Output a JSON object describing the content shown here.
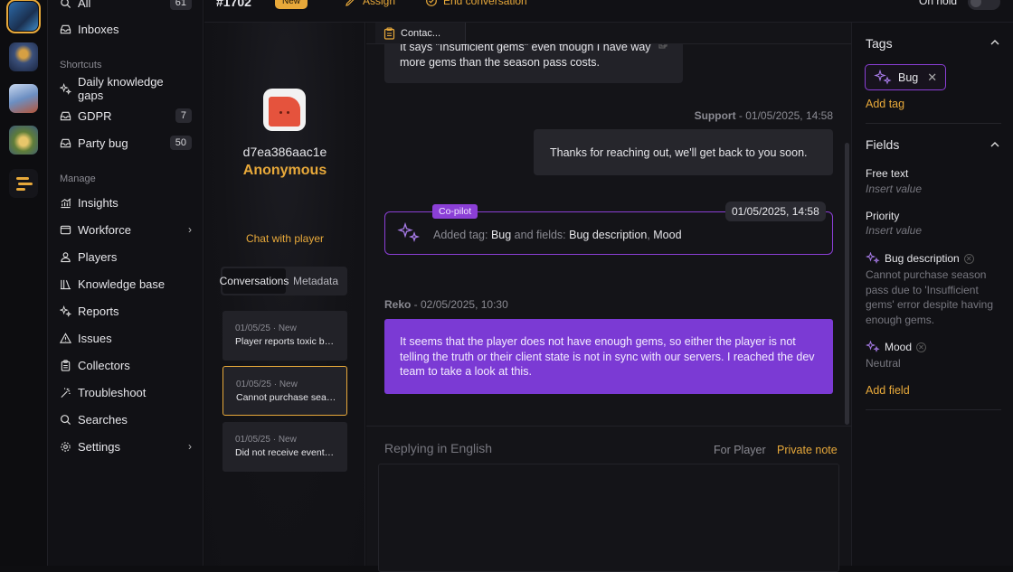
{
  "topbar": {
    "ticket_id": "#1702",
    "status_badge": "New",
    "assign_label": "Assign",
    "end_label": "End conversation",
    "on_hold_label": "On hold"
  },
  "sidebar": {
    "top_item": {
      "label": "All",
      "count": "61"
    },
    "inboxes": {
      "label": "Inboxes"
    },
    "shortcuts_title": "Shortcuts",
    "shortcuts": [
      {
        "label": "Daily knowledge gaps",
        "icon": "sparkle-icon"
      },
      {
        "label": "GDPR",
        "icon": "inbox-icon",
        "count": "7"
      },
      {
        "label": "Party bug",
        "icon": "inbox-icon",
        "count": "50"
      }
    ],
    "manage_title": "Manage",
    "manage": [
      {
        "label": "Insights",
        "icon": "chart-icon"
      },
      {
        "label": "Workforce",
        "icon": "window-icon"
      },
      {
        "label": "Players",
        "icon": "user-icon"
      },
      {
        "label": "Knowledge base",
        "icon": "library-icon"
      },
      {
        "label": "Reports",
        "icon": "sparkle-icon"
      },
      {
        "label": "Issues",
        "icon": "warning-icon"
      },
      {
        "label": "Collectors",
        "icon": "clipboard-icon"
      },
      {
        "label": "Troubleshoot",
        "icon": "wand-icon"
      },
      {
        "label": "Searches",
        "icon": "search-icon"
      },
      {
        "label": "Settings",
        "icon": "gear-icon"
      }
    ]
  },
  "player": {
    "id": "d7ea386aac1e",
    "name": "Anonymous",
    "chat_link": "Chat with player",
    "tabs": [
      "Conversations",
      "Metadata"
    ],
    "conversations": [
      {
        "meta": "01/05/25 · New",
        "title": "Player reports toxic be..."
      },
      {
        "meta": "01/05/25 · New",
        "title": "Cannot purchase seas..."
      },
      {
        "meta": "01/05/25 · New",
        "title": "Did not receive event r..."
      }
    ]
  },
  "chat": {
    "contact_tab": "Contac...",
    "player_msg_tail_1": "It says \"Insufficient gems\" even though I have way",
    "player_msg_tail_2": "more gems than the season pass costs.",
    "support_header_name": "Support",
    "support_header_time": " - 01/05/2025, 14:58",
    "support_msg": "Thanks for reaching out, we'll get back to you soon.",
    "copilot_badge": "Co-pilot",
    "copilot_time": "01/05/2025, 14:58",
    "copilot_prefix": "Added tag: ",
    "copilot_tag": "Bug",
    "copilot_mid": " and fields: ",
    "copilot_field1": "Bug description",
    "copilot_sep": ", ",
    "copilot_field2": "Mood",
    "agent_header_name": "Reko",
    "agent_header_time": " - 02/05/2025, 10:30",
    "agent_msg": "It seems that the player does not have enough gems, so either the player is not telling the truth or their client state is not in sync with our servers. I reached the dev team to take a look at this."
  },
  "composer": {
    "replying": "Replying in English",
    "for_player": "For Player",
    "private_note": "Private note"
  },
  "right": {
    "tags_title": "Tags",
    "tag": "Bug",
    "add_tag": "Add tag",
    "fields_title": "Fields",
    "free_text_label": "Free text",
    "free_text_value": "Insert value",
    "priority_label": "Priority",
    "priority_value": "Insert value",
    "bug_desc_label": "Bug description",
    "bug_desc_value": "Cannot purchase season pass due to 'Insufficient gems' error despite having enough gems.",
    "mood_label": "Mood",
    "mood_value": "Neutral",
    "add_field": "Add field"
  },
  "colors": {
    "accent": "#e8a93a",
    "copilot": "#8b3fd6",
    "agent_bubble": "#7b3ad4"
  }
}
